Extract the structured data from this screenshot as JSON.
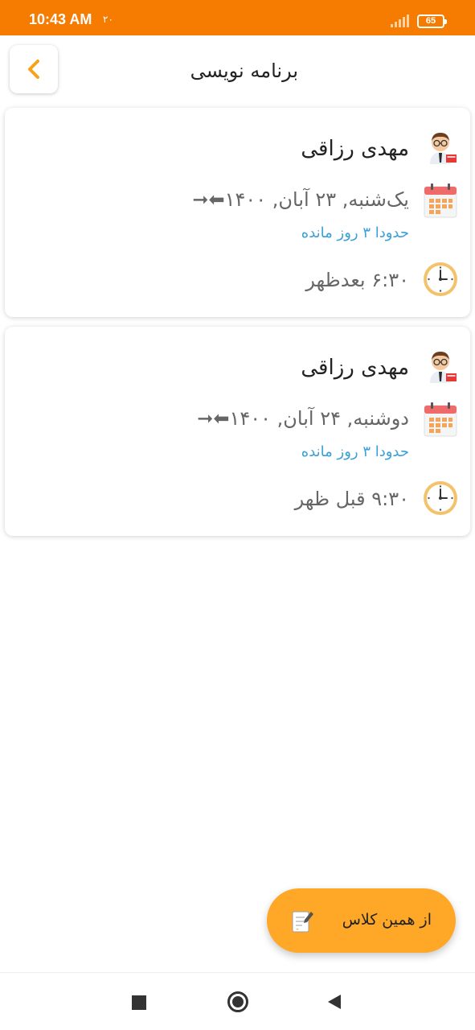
{
  "status_bar": {
    "time": "10:43 AM",
    "extra": "۲۰",
    "battery": "65",
    "signal_icon": "signal-icon"
  },
  "header": {
    "title": "برنامه نویسی",
    "back_icon": "chevron-left-icon",
    "accent_color": "#f7a21b"
  },
  "sessions": [
    {
      "teacher": "مهدی رزاقی",
      "date": "یک‌شنبه, ۲۳ آبان, ۱۴۰۰⬅︎➞",
      "remaining": "حدودا ۳ روز مانده",
      "time": "۶:۳۰ بعدظهر"
    },
    {
      "teacher": "مهدی رزاقی",
      "date": "دوشنبه, ۲۴ آبان, ۱۴۰۰⬅︎➞",
      "remaining": "حدودا ۳ روز مانده",
      "time": "۹:۳۰ قبل ظهر"
    }
  ],
  "fab": {
    "label": "از همین کلاس",
    "icon": "note-edit-icon",
    "color": "#ffa726"
  },
  "colors": {
    "status_bar": "#f57c00",
    "remaining_text": "#3aa0d8"
  },
  "nav": {
    "recent_icon": "square-icon",
    "home_icon": "circle-icon",
    "back_icon": "triangle-back-icon"
  }
}
